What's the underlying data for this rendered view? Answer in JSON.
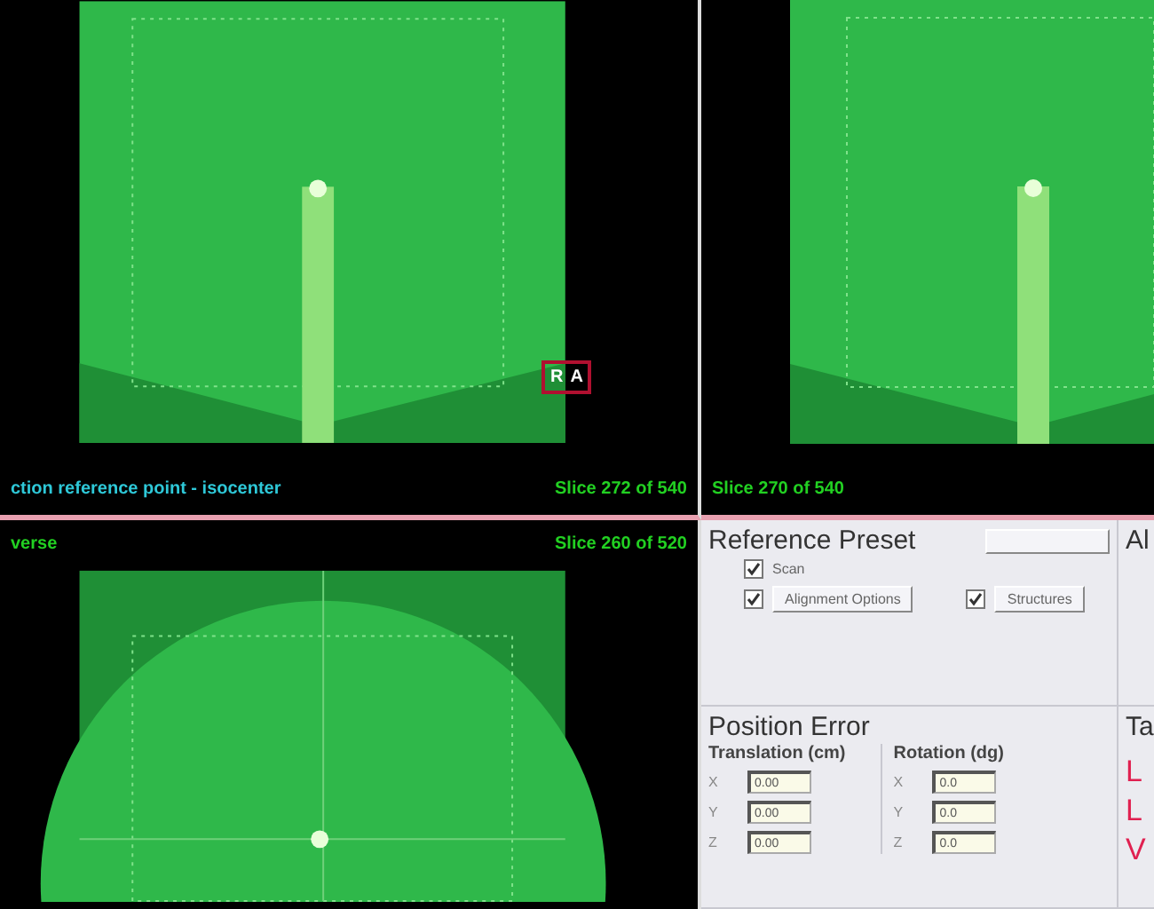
{
  "viewports": [
    {
      "kind": "coronal",
      "caption": "ction reference point - isocenter",
      "slice": "Slice 272 of 540",
      "orientation_labels": [
        "R",
        "A"
      ]
    },
    {
      "kind": "coronal",
      "slice": "Slice 270 of 540"
    },
    {
      "kind": "transverse",
      "caption": "verse",
      "slice": "Slice 260 of 520"
    }
  ],
  "reference_preset": {
    "title": "Reference Preset",
    "options": [
      {
        "label": "Scan",
        "checked": true,
        "kind": "plain"
      },
      {
        "label": "Alignment Options",
        "checked": true,
        "kind": "button"
      },
      {
        "label": "Structures",
        "checked": true,
        "kind": "button"
      }
    ]
  },
  "next_panel_heading": "Al",
  "position_error": {
    "title": "Position Error",
    "groups": [
      {
        "label": "Translation (cm)",
        "rows": [
          {
            "axis": "X",
            "value": "0.00"
          },
          {
            "axis": "Y",
            "value": "0.00"
          },
          {
            "axis": "Z",
            "value": "0.00"
          }
        ]
      },
      {
        "label": "Rotation (dg)",
        "rows": [
          {
            "axis": "X",
            "value": "0.0"
          },
          {
            "axis": "Y",
            "value": "0.0"
          },
          {
            "axis": "Z",
            "value": "0.0"
          }
        ]
      }
    ]
  },
  "table_panel": {
    "heading": "Ta",
    "letters": [
      "L",
      "L",
      "V"
    ]
  }
}
